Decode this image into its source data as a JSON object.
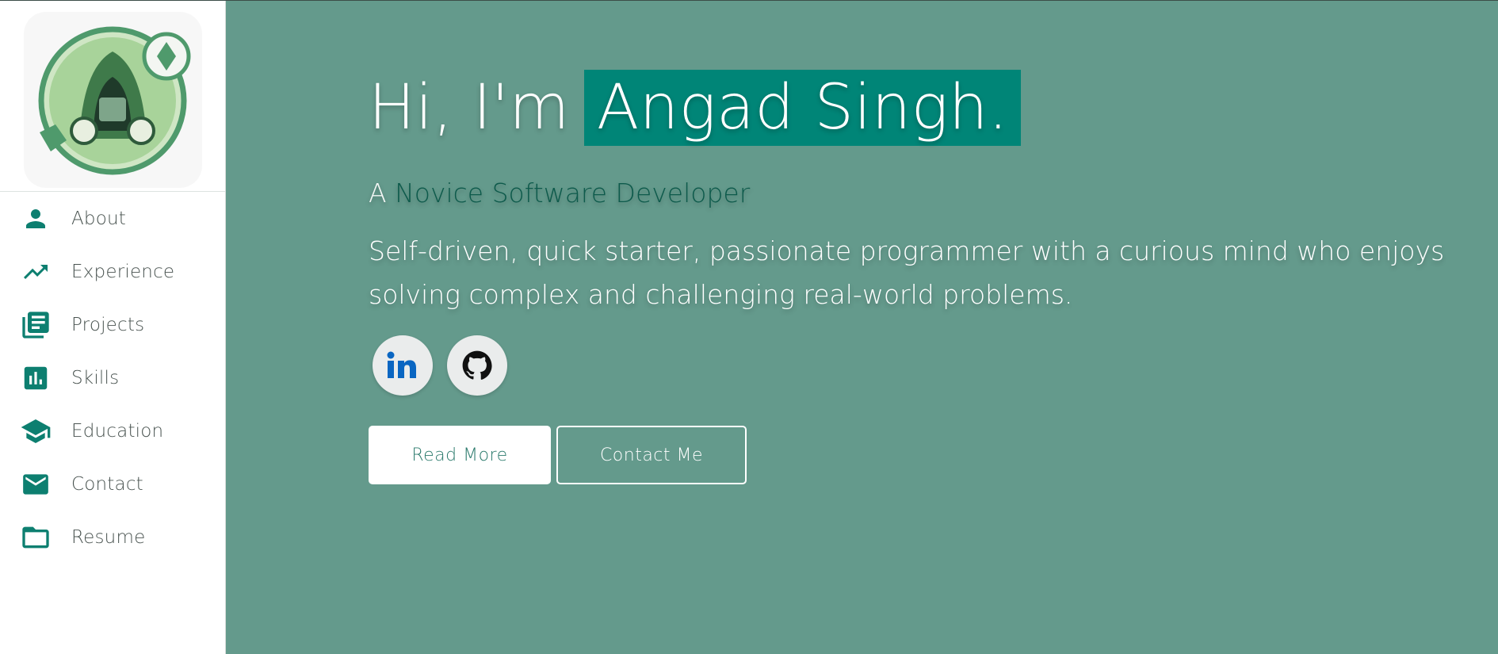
{
  "sidebar": {
    "nav": [
      {
        "label": "About",
        "icon": "person-icon"
      },
      {
        "label": "Experience",
        "icon": "trending-up-icon"
      },
      {
        "label": "Projects",
        "icon": "library-books-icon"
      },
      {
        "label": "Skills",
        "icon": "bar-chart-icon"
      },
      {
        "label": "Education",
        "icon": "graduation-cap-icon"
      },
      {
        "label": "Contact",
        "icon": "mail-icon"
      },
      {
        "label": "Resume",
        "icon": "folder-icon"
      }
    ]
  },
  "hero": {
    "greeting": "Hi, I'm",
    "name": "Angad Singh.",
    "subtitle_prefix": "A",
    "role": "Novice Software Developer",
    "description": "Self-driven, quick starter, passionate programmer with a curious mind who enjoys solving complex and challenging real-world problems.",
    "social": [
      {
        "icon": "linkedin-icon"
      },
      {
        "icon": "github-icon"
      }
    ],
    "read_more_label": "Read More",
    "contact_label": "Contact Me"
  },
  "colors": {
    "accent": "#008577",
    "background": "#649a8c",
    "sidebar_icon": "#0d7f70",
    "role_text": "#0d5a4b"
  }
}
